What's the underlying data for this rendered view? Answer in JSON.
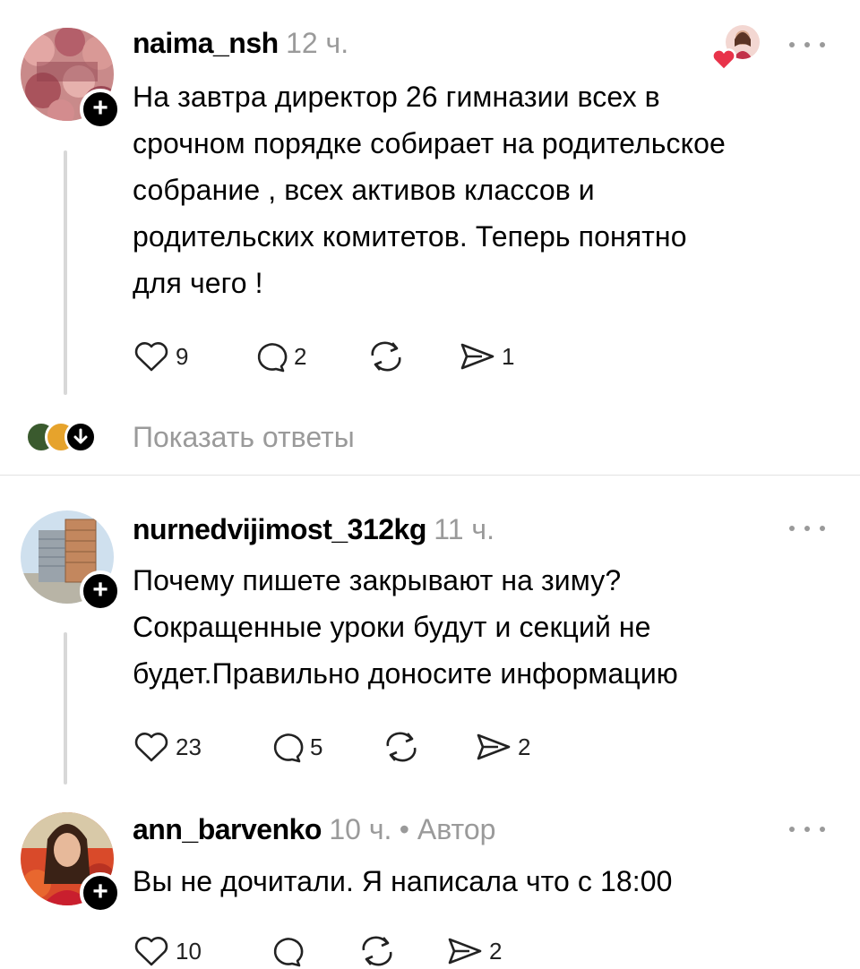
{
  "comments": [
    {
      "username": "naima_nsh",
      "time": "12 ч.",
      "text_lines": [
        "На завтра директор 26 гимназии всех в",
        "срочном порядке собирает на родительское",
        "собрание , всех активов классов и",
        "родительских комитетов. Теперь понятно",
        "для чего !"
      ],
      "likes": "9",
      "replies": "2",
      "reposts": "",
      "shares": "1",
      "avatar_icon": "flowers-avatar",
      "liked_by_author_icon": "author-heart-icon"
    },
    {
      "username": "nurnedvijimost_312kg",
      "time": "11 ч.",
      "text_lines": [
        "Почему пишете закрывают на зиму?",
        "Сокращенные уроки будут и секций не",
        "будет.Правильно доносите информацию"
      ],
      "likes": "23",
      "replies": "5",
      "reposts": "",
      "shares": "2",
      "avatar_icon": "building-avatar"
    },
    {
      "username": "ann_barvenko",
      "time": "10 ч.",
      "author_tag": "• Автор",
      "text_lines": [
        "Вы не дочитали. Я написала что с 18:00"
      ],
      "likes": "10",
      "replies": "",
      "reposts": "",
      "shares": "2",
      "avatar_icon": "woman-portrait-avatar"
    }
  ],
  "show_replies_label": "Показать ответы",
  "colors": {
    "text": "#000000",
    "muted": "#9a9a9a",
    "divider": "#e2e2e2",
    "heart": "#e8334a"
  }
}
